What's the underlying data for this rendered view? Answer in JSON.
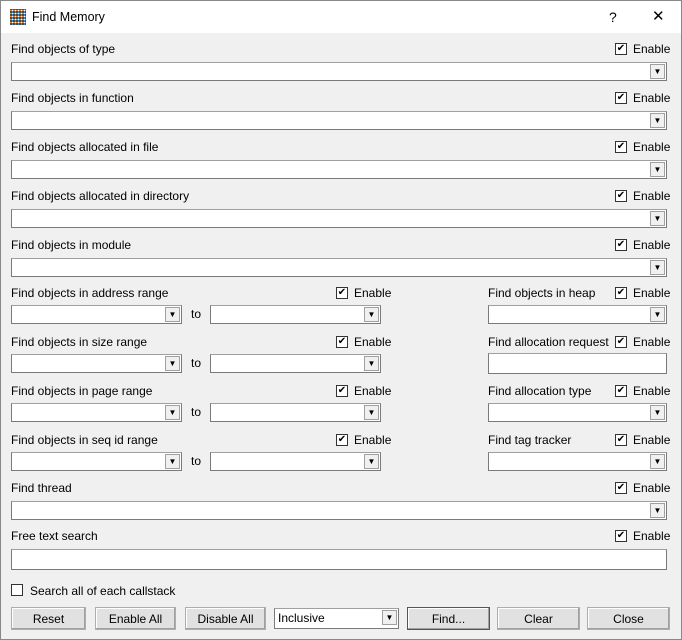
{
  "window": {
    "title": "Find Memory",
    "help": "?",
    "close": "✕",
    "icon": "grid-app-icon"
  },
  "enable_label": "Enable",
  "to_label": "to",
  "full_rows": [
    {
      "label": "Find objects of type",
      "enabled": true,
      "value": ""
    },
    {
      "label": "Find objects in function",
      "enabled": true,
      "value": ""
    },
    {
      "label": "Find objects allocated in file",
      "enabled": true,
      "value": ""
    },
    {
      "label": "Find objects allocated in directory",
      "enabled": true,
      "value": ""
    },
    {
      "label": "Find objects in module",
      "enabled": true,
      "value": ""
    }
  ],
  "range_rows": [
    {
      "label": "Find objects in address range",
      "enabled": true,
      "from": "",
      "to": ""
    },
    {
      "label": "Find objects in size range",
      "enabled": true,
      "from": "",
      "to": ""
    },
    {
      "label": "Find objects in page range",
      "enabled": true,
      "from": "",
      "to": ""
    },
    {
      "label": "Find objects in seq id range",
      "enabled": true,
      "from": "",
      "to": ""
    }
  ],
  "right_rows": [
    {
      "label": "Find objects in heap",
      "enabled": true,
      "type": "combo",
      "value": ""
    },
    {
      "label": "Find allocation request",
      "enabled": true,
      "type": "text",
      "value": ""
    },
    {
      "label": "Find allocation type",
      "enabled": true,
      "type": "combo",
      "value": ""
    },
    {
      "label": "Find tag tracker",
      "enabled": true,
      "type": "combo",
      "value": ""
    }
  ],
  "thread": {
    "label": "Find thread",
    "enabled": true,
    "value": ""
  },
  "free_text": {
    "label": "Free text search",
    "enabled": true,
    "value": ""
  },
  "callstack": {
    "label": "Search all of each callstack",
    "checked": false
  },
  "buttons": {
    "reset": "Reset",
    "enable_all": "Enable All",
    "disable_all": "Disable All",
    "find": "Find...",
    "clear": "Clear",
    "close": "Close"
  },
  "mode": {
    "value": "Inclusive"
  }
}
